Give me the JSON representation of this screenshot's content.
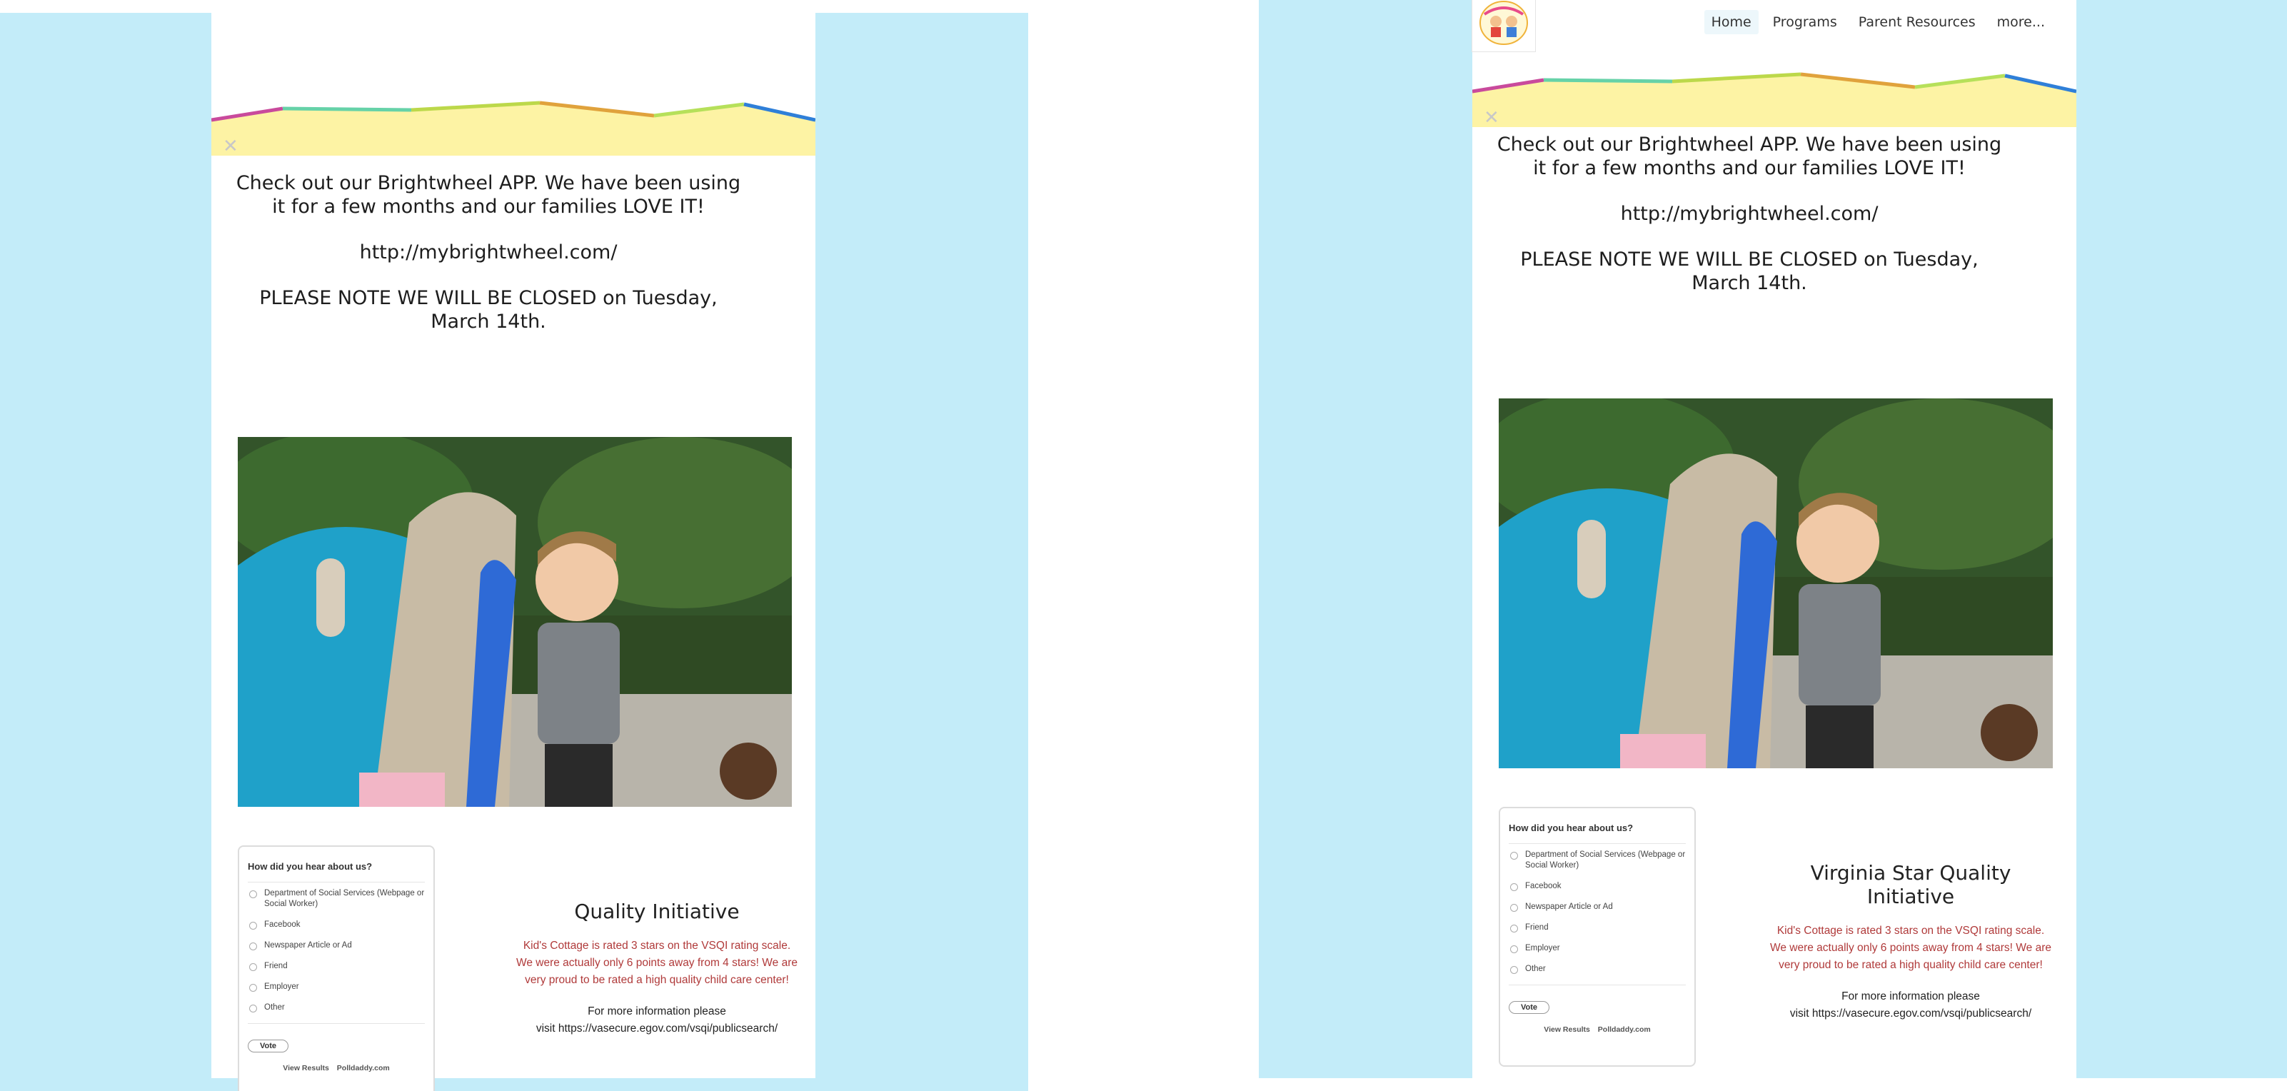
{
  "nav": {
    "items": [
      "Home",
      "Programs",
      "Parent Resources",
      "more..."
    ]
  },
  "close_glyph": "✕",
  "announcement": {
    "para1": "Check out our Brightwheel APP.  We have been using it for a few months and our families LOVE IT!",
    "para2": "http://mybrightwheel.com/",
    "para3": "PLEASE NOTE WE WILL BE CLOSED on Tuesday, March 14th."
  },
  "poll": {
    "question": "How did you hear about us?",
    "options": [
      "Department of Social Services (Webpage or Social Worker)",
      "Facebook",
      "Newspaper Article or Ad",
      "Friend",
      "Employer",
      "Other"
    ],
    "vote_label": "Vote",
    "view_results": "View Results",
    "polldaddy": "Polldaddy.com"
  },
  "quality_left": {
    "title": "Quality Initiative",
    "body": "Kid's Cottage is rated 3 stars on the VSQI rating scale.  We were actually only 6 points away from 4 stars! We are very proud to be rated a high quality child care center!",
    "info_line1": "For more information please",
    "info_line2": "visit https://vasecure.egov.com/vsqi/publicsearch/"
  },
  "quality_right": {
    "title": "Virginia Star Quality Initiative",
    "body": "Kid's Cottage is rated 3 stars on the VSQI rating scale.  We were actually only 6 points away from 4 stars! We are very proud to be rated a high quality child care center!",
    "info_line1": "For more information please",
    "info_line2": "visit https://vasecure.egov.com/vsqi/publicsearch/"
  },
  "colors": {
    "page_background": "#c3ecf9",
    "banner_fill": "#fdf3a4",
    "quality_text": "#b03a3a"
  },
  "icons": {
    "logo": "kids-cottage-logo",
    "close": "close-icon"
  }
}
